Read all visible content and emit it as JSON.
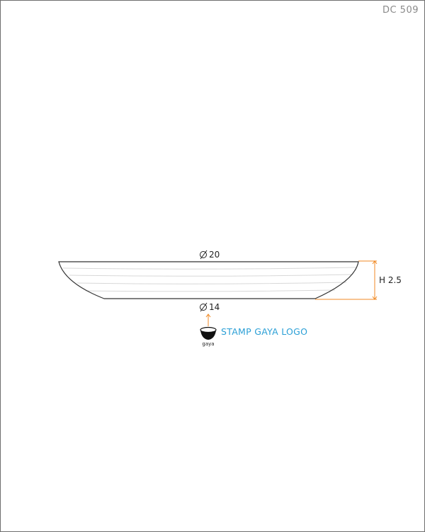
{
  "product_code": "DC 509",
  "dimensions": {
    "top_diameter": "20",
    "bottom_diameter": "14",
    "height": "H 2.5"
  },
  "stamp": {
    "note": "STAMP GAYA LOGO",
    "logo_text": "gaya"
  },
  "colors": {
    "dimension_line": "#f08a24",
    "note_text": "#2a9fd6",
    "outline": "#333333",
    "contour": "#d8d8d8"
  }
}
